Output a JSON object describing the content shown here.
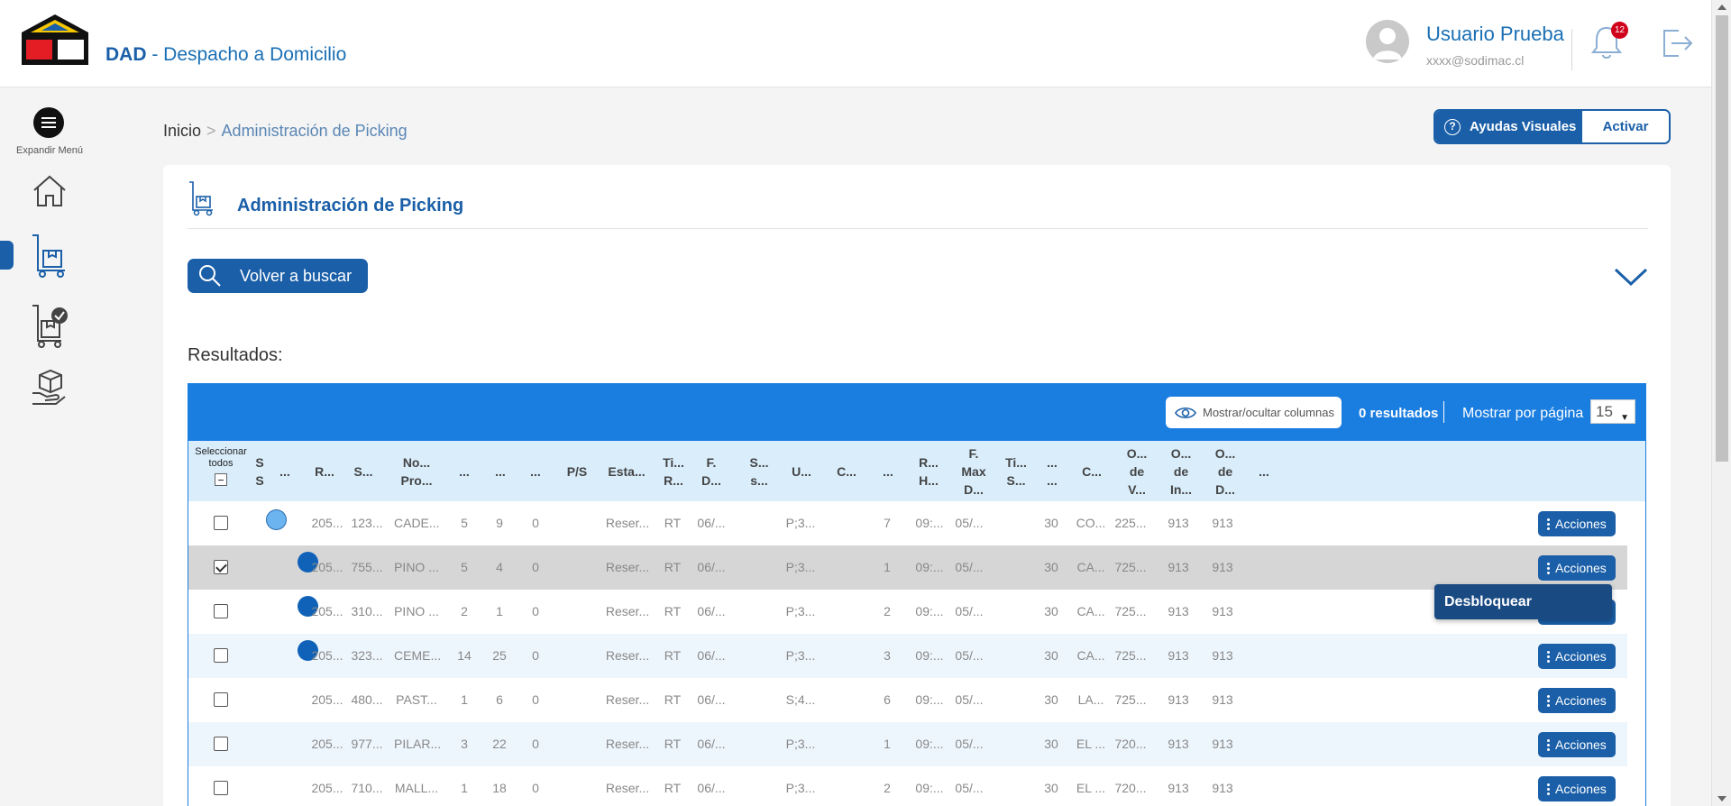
{
  "header": {
    "app_title_strong": "DAD",
    "app_title_rest": " - Despacho a Domicilio",
    "user_name": "Usuario Prueba",
    "user_email": "xxxx@sodimac.cl",
    "notification_count": "12"
  },
  "sidebar": {
    "expand_label": "Expandir Menú",
    "items": [
      "home-icon",
      "picking-cart-icon",
      "picking-done-icon",
      "delivery-hand-icon"
    ]
  },
  "breadcrumb": {
    "home": "Inicio",
    "separator": ">",
    "current": "Administración de Picking"
  },
  "visual_help": {
    "label": "Ayudas Visuales",
    "action": "Activar",
    "icon_glyph": "?"
  },
  "card": {
    "title": "Administración de Picking",
    "search_button": "Volver a buscar",
    "results_label": "Resultados:"
  },
  "table": {
    "toggle_columns": "Mostrar/ocultar columnas",
    "result_count": "0 resultados",
    "per_page_label": "Mostrar por página",
    "per_page_value": "15",
    "select_all": "Seleccionar todos",
    "headers": [
      "S S",
      "...",
      "R...",
      "S...",
      "No... Pro...",
      "...",
      "...",
      "...",
      "P/S",
      "Esta...",
      "Ti... R...",
      "F. D...",
      "S... s...",
      "U...",
      "C...",
      "...",
      "R... H...",
      "F. Max D...",
      "Ti... S...",
      "... ...",
      "C...",
      "O... de V...",
      "O... de In...",
      "O... de D...",
      "..."
    ],
    "action_label": "Acciones",
    "rows": [
      {
        "checked": false,
        "dot": "light",
        "cells": [
          "205...",
          "123...",
          "CADE...",
          "5",
          "9",
          "0",
          "",
          "Reser...",
          "RT",
          "06/...",
          "",
          "P;3...",
          "",
          "7",
          "09:...",
          "05/...",
          "",
          "30",
          "CO...",
          "225...",
          "913",
          "913"
        ]
      },
      {
        "checked": true,
        "dot": "dark",
        "cells": [
          "205...",
          "755...",
          "PINO ...",
          "5",
          "4",
          "0",
          "",
          "Reser...",
          "RT",
          "06/...",
          "",
          "P;3...",
          "",
          "1",
          "09:...",
          "05/...",
          "",
          "30",
          "CA...",
          "725...",
          "913",
          "913"
        ]
      },
      {
        "checked": false,
        "dot": "dark",
        "cells": [
          "205...",
          "310...",
          "PINO ...",
          "2",
          "1",
          "0",
          "",
          "Reser...",
          "RT",
          "06/...",
          "",
          "P;3...",
          "",
          "2",
          "09:...",
          "05/...",
          "",
          "30",
          "CA...",
          "725...",
          "913",
          "913"
        ]
      },
      {
        "checked": false,
        "dot": "dark",
        "cells": [
          "205...",
          "323...",
          "CEME...",
          "14",
          "25",
          "0",
          "",
          "Reser...",
          "RT",
          "06/...",
          "",
          "P;3...",
          "",
          "3",
          "09:...",
          "05/...",
          "",
          "30",
          "CA...",
          "725...",
          "913",
          "913"
        ]
      },
      {
        "checked": false,
        "dot": "",
        "cells": [
          "205...",
          "480...",
          "PAST...",
          "1",
          "6",
          "0",
          "",
          "Reser...",
          "RT",
          "06/...",
          "",
          "S;4...",
          "",
          "6",
          "09:...",
          "05/...",
          "",
          "30",
          "LA...",
          "725...",
          "913",
          "913"
        ]
      },
      {
        "checked": false,
        "dot": "",
        "cells": [
          "205...",
          "977...",
          "PILAR...",
          "3",
          "22",
          "0",
          "",
          "Reser...",
          "RT",
          "06/...",
          "",
          "P;3...",
          "",
          "1",
          "09:...",
          "05/...",
          "",
          "30",
          "EL ...",
          "720...",
          "913",
          "913"
        ]
      },
      {
        "checked": false,
        "dot": "",
        "cells": [
          "205...",
          "710...",
          "MALL...",
          "1",
          "18",
          "0",
          "",
          "Reser...",
          "RT",
          "06/...",
          "",
          "P;3...",
          "",
          "2",
          "09:...",
          "05/...",
          "",
          "30",
          "EL ...",
          "720...",
          "913",
          "913"
        ]
      }
    ]
  },
  "popup": {
    "label": "Desbloquear"
  },
  "colors": {
    "primary": "#1a5fa8",
    "table_header_bar": "#1a7de0",
    "dot_light": "#6cb4f0",
    "dot_dark": "#0f62b7",
    "badge": "#d0021b"
  }
}
